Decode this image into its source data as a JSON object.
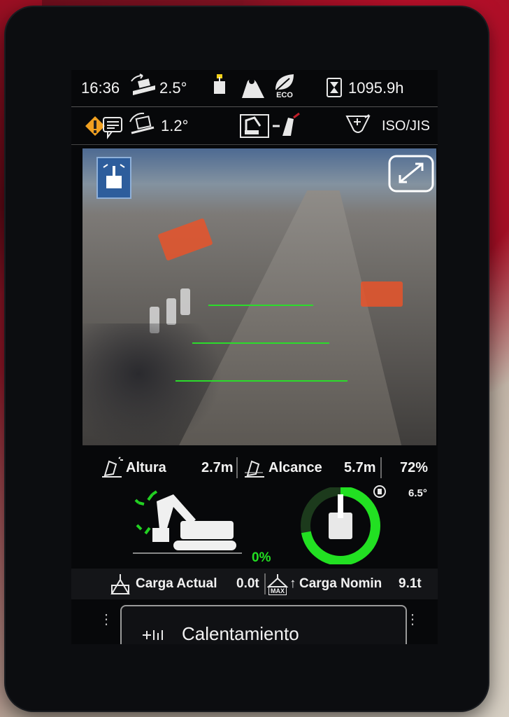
{
  "status_bar": {
    "time": "16:36",
    "tilt_front_value": "2.5°",
    "eco_label": "ECO",
    "hour_meter": "1095.9h"
  },
  "status_bar_2": {
    "tilt_side_value": "1.2°",
    "pattern_label": "ISO/JIS"
  },
  "camera": {
    "guide_line_color": "#2bdc2b"
  },
  "measurements": {
    "height_label": "Altura",
    "height_value": "2.7m",
    "reach_label": "Alcance",
    "reach_value": "5.7m",
    "percent_value": "72%"
  },
  "machine": {
    "swing_percent": "0%",
    "bucket_angle": "6.5°",
    "ring_color": "#22e022",
    "bucket_fill": 0.72
  },
  "load": {
    "actual_label": "Carga Actual",
    "actual_value": "0.0t",
    "max_badge": "MAX",
    "nominal_label": "Carga Nomin",
    "nominal_value": "9.1t"
  },
  "warmup": {
    "label": "Calentamiento"
  }
}
